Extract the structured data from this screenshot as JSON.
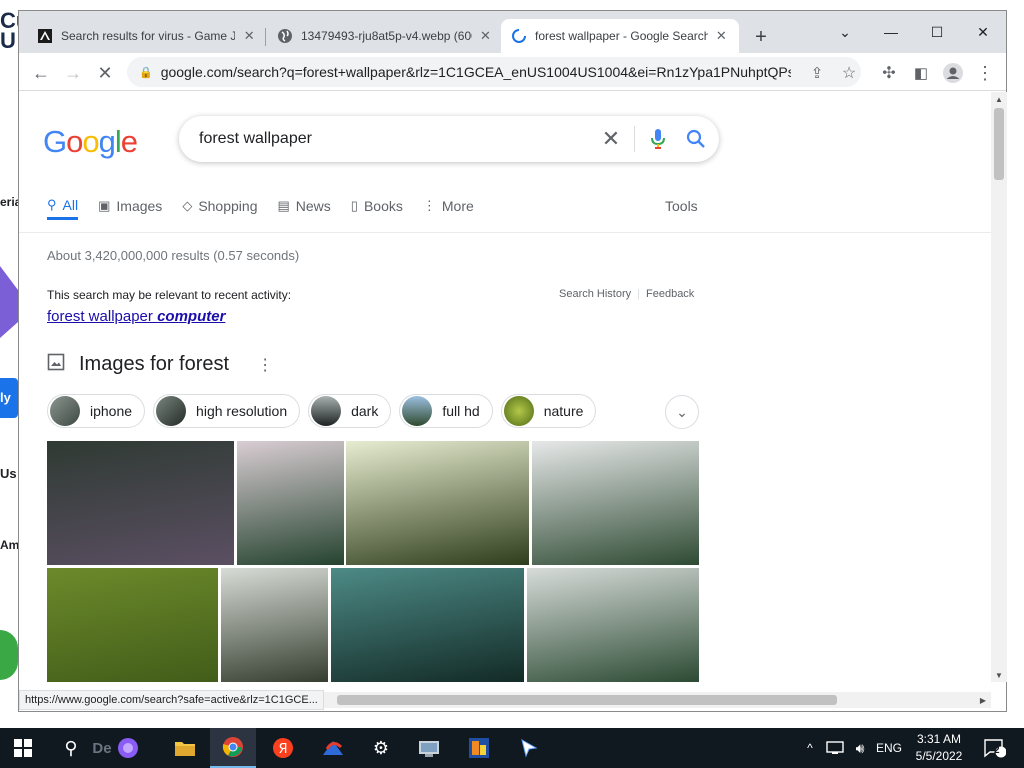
{
  "desktop": {
    "fragments": [
      "Cu",
      "U",
      "eria",
      "ly",
      "Us",
      "Am",
      "De"
    ]
  },
  "browser": {
    "tabs": [
      {
        "title": "Search results for virus - Game Jo",
        "favicon": "gamejolt-icon",
        "active": false
      },
      {
        "title": "13479493-rju8at5p-v4.webp (600",
        "favicon": "globe-icon",
        "active": false
      },
      {
        "title": "forest wallpaper - Google Search",
        "favicon": "loading-icon",
        "active": true
      }
    ],
    "new_tab_label": "+",
    "window_controls": {
      "tab_search": "⌄",
      "minimize": "—",
      "maximize": "☐",
      "close": "✕"
    },
    "url": "google.com/search?q=forest+wallpaper&rlz=1C1GCEA_enUS1004US1004&ei=Rn1zYpa1PNuhptQPs...",
    "status_url": "https://www.google.com/search?safe=active&rlz=1C1GCE..."
  },
  "google": {
    "logo_letters": [
      {
        "ch": "G",
        "color": "#4285f4"
      },
      {
        "ch": "o",
        "color": "#ea4335"
      },
      {
        "ch": "o",
        "color": "#fbbc05"
      },
      {
        "ch": "g",
        "color": "#4285f4"
      },
      {
        "ch": "l",
        "color": "#34a853"
      },
      {
        "ch": "e",
        "color": "#ea4335"
      }
    ],
    "query": "forest wallpaper",
    "nav": [
      {
        "label": "All",
        "icon": "search-icon",
        "active": true
      },
      {
        "label": "Images",
        "icon": "image-icon",
        "active": false
      },
      {
        "label": "Shopping",
        "icon": "tag-icon",
        "active": false
      },
      {
        "label": "News",
        "icon": "news-icon",
        "active": false
      },
      {
        "label": "Books",
        "icon": "book-icon",
        "active": false
      },
      {
        "label": "More",
        "icon": "more-vert-icon",
        "active": false
      }
    ],
    "tools_label": "Tools",
    "result_stats": "About 3,420,000,000 results (0.57 seconds)",
    "relevant_notice": "This search may be relevant to recent activity:",
    "search_history_label": "Search History",
    "feedback_label": "Feedback",
    "suggestion": {
      "prefix": "forest wallpaper ",
      "bold": "computer"
    },
    "images_heading": "Images for forest",
    "chips": [
      {
        "label": "iphone",
        "thumb_color": "#5d6b63"
      },
      {
        "label": "high resolution",
        "thumb_color": "#3f4a45"
      },
      {
        "label": "dark",
        "thumb_color": "#2c3433"
      },
      {
        "label": "full hd",
        "thumb_color": "#4f7aa0"
      },
      {
        "label": "nature",
        "thumb_color": "#7d9a2a"
      }
    ],
    "images": [
      {
        "name": "misty-dark-forest",
        "c1": "#2f3a33",
        "c2": "#5b4f63"
      },
      {
        "name": "pink-fog-pines",
        "c1": "#d9cdd3",
        "c2": "#25432f"
      },
      {
        "name": "sun-through-trees",
        "c1": "#e7ecd0",
        "c2": "#2e3d1b"
      },
      {
        "name": "foggy-mountain-forest",
        "c1": "#e6e8e8",
        "c2": "#2e4a33"
      },
      {
        "name": "mossy-redwoods",
        "c1": "#6c8a2b",
        "c2": "#3f5a18"
      },
      {
        "name": "wooden-path",
        "c1": "#d8dcd6",
        "c2": "#283223"
      },
      {
        "name": "teal-misty-valley",
        "c1": "#4d8a86",
        "c2": "#0f2420"
      },
      {
        "name": "foggy-green-hills",
        "c1": "#d7dcd9",
        "c2": "#204028"
      },
      {
        "name": "partial-1",
        "c1": "#7a5a3a",
        "c2": "#4a3826"
      },
      {
        "name": "partial-2",
        "c1": "#6a7a3a",
        "c2": "#3d4a20"
      },
      {
        "name": "partial-3",
        "c1": "#c9b07a",
        "c2": "#8a6e3a"
      },
      {
        "name": "partial-4",
        "c1": "#3a6a7a",
        "c2": "#1d3b48"
      }
    ]
  },
  "taskbar": {
    "search_text": "De",
    "language": "ENG",
    "time": "3:31 AM",
    "date": "5/5/2022",
    "notification_count": "2"
  }
}
